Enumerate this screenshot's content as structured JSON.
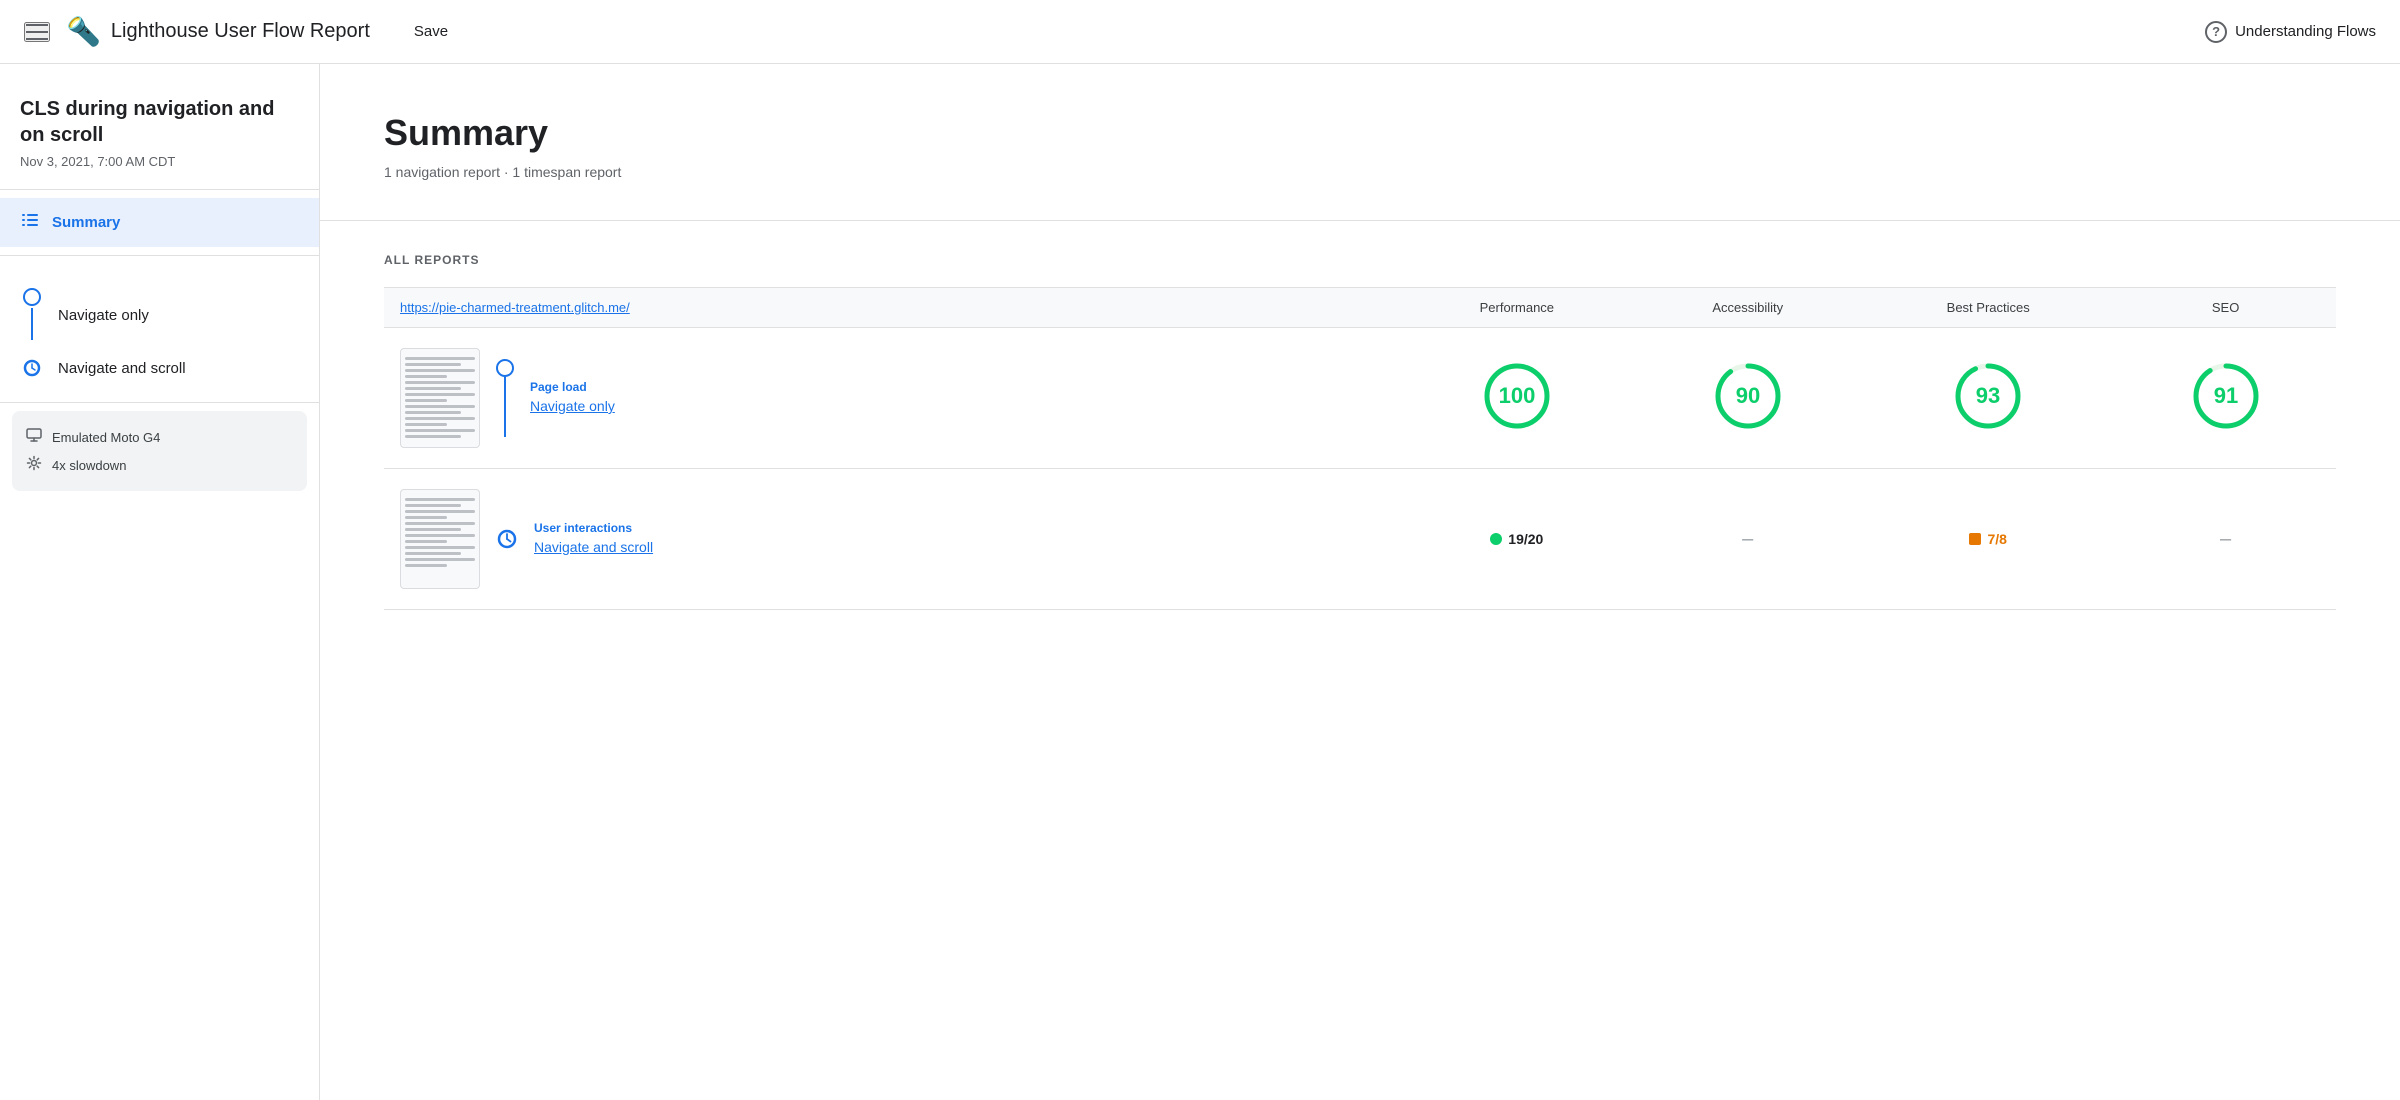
{
  "header": {
    "menu_label": "menu",
    "logo": "🔦",
    "title": "Lighthouse User Flow Report",
    "save_label": "Save",
    "help_label": "Understanding Flows"
  },
  "sidebar": {
    "project_title": "CLS during navigation and on scroll",
    "project_date": "Nov 3, 2021, 7:00 AM CDT",
    "summary_label": "Summary",
    "steps": [
      {
        "id": "navigate-only",
        "label": "Navigate only",
        "type": "circle"
      },
      {
        "id": "navigate-scroll",
        "label": "Navigate and scroll",
        "type": "clock"
      }
    ],
    "env": [
      {
        "icon": "monitor",
        "label": "Emulated Moto G4"
      },
      {
        "icon": "gear",
        "label": "4x slowdown"
      }
    ]
  },
  "main": {
    "summary": {
      "title": "Summary",
      "subtitle": "1 navigation report · 1 timespan report"
    },
    "reports_heading": "ALL REPORTS",
    "table_url": "https://pie-charmed-treatment.glitch.me/",
    "columns": [
      "Performance",
      "Accessibility",
      "Best Practices",
      "SEO"
    ],
    "rows": [
      {
        "type": "Page load",
        "name": "Navigate only",
        "step_type": "circle",
        "scores": [
          {
            "value": "100",
            "kind": "circle",
            "color": "#0cce6b",
            "stroke": "#0cce6b"
          },
          {
            "value": "90",
            "kind": "circle",
            "color": "#0cce6b",
            "stroke": "#0cce6b"
          },
          {
            "value": "93",
            "kind": "circle",
            "color": "#0cce6b",
            "stroke": "#0cce6b"
          },
          {
            "value": "91",
            "kind": "circle",
            "color": "#0cce6b",
            "stroke": "#0cce6b"
          }
        ]
      },
      {
        "type": "User interactions",
        "name": "Navigate and scroll",
        "step_type": "clock",
        "scores": [
          {
            "value": "19/20",
            "kind": "badge-dot",
            "color": "#0cce6b"
          },
          {
            "value": "–",
            "kind": "dash"
          },
          {
            "value": "7/8",
            "kind": "badge-square",
            "color": "#e67700"
          },
          {
            "value": "–",
            "kind": "dash"
          }
        ]
      }
    ]
  }
}
